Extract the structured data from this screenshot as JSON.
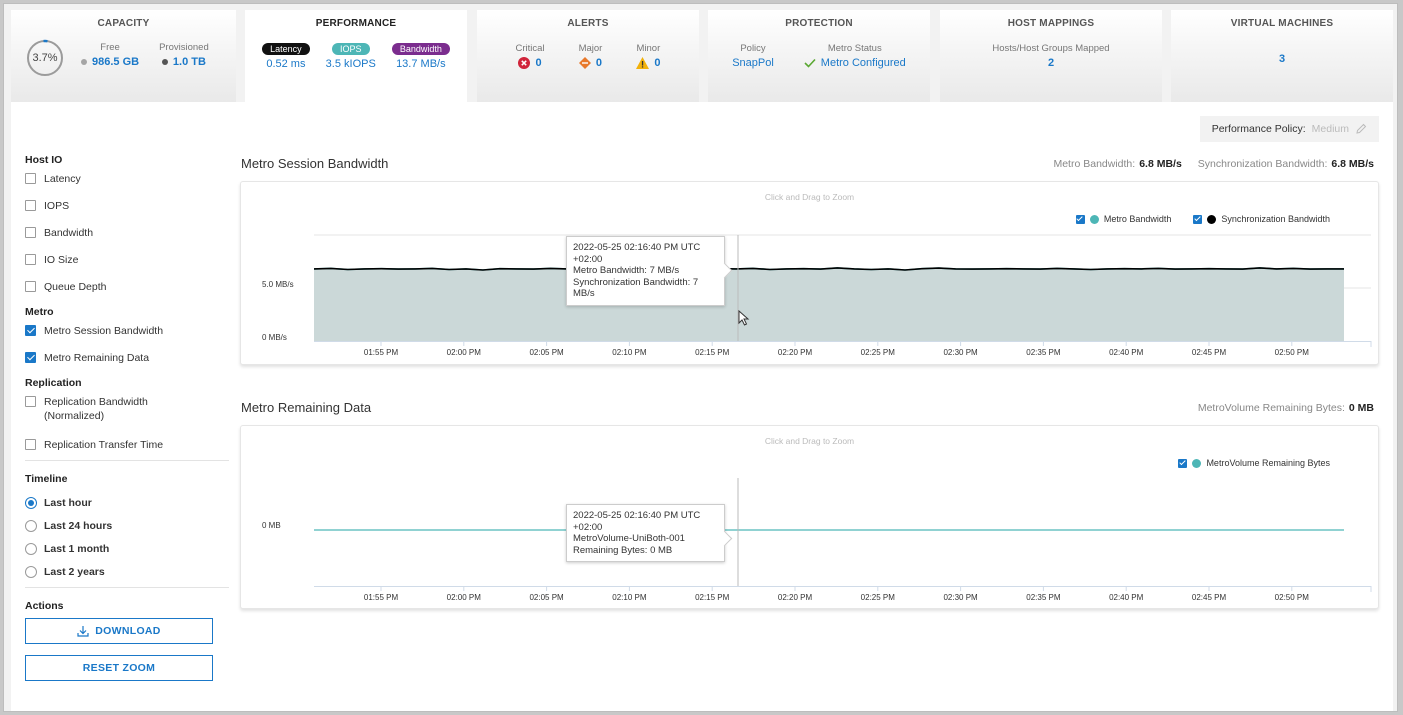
{
  "tiles": {
    "capacity": {
      "title": "CAPACITY",
      "percent_label": "3.7%",
      "percent_value": 3.7,
      "free_label": "Free",
      "free_value": "986.5 GB",
      "provisioned_label": "Provisioned",
      "provisioned_value": "1.0 TB"
    },
    "performance": {
      "title": "PERFORMANCE",
      "latency_label": "Latency",
      "latency_value": "0.52 ms",
      "iops_label": "IOPS",
      "iops_value": "3.5 kIOPS",
      "bandwidth_label": "Bandwidth",
      "bandwidth_value": "13.7 MB/s"
    },
    "alerts": {
      "title": "ALERTS",
      "critical_label": "Critical",
      "critical_value": "0",
      "major_label": "Major",
      "major_value": "0",
      "minor_label": "Minor",
      "minor_value": "0"
    },
    "protection": {
      "title": "PROTECTION",
      "policy_label": "Policy",
      "policy_value": "SnapPol",
      "metro_label": "Metro Status",
      "metro_value": "Metro Configured"
    },
    "host_mappings": {
      "title": "HOST MAPPINGS",
      "label": "Hosts/Host Groups Mapped",
      "value": "2"
    },
    "virtual_machines": {
      "title": "VIRTUAL MACHINES",
      "value": "3"
    }
  },
  "colors": {
    "accent": "#1a78c8",
    "latency_pill": "#111111",
    "iops_pill": "#4db6b6",
    "bandwidth_pill": "#7b2d8e",
    "critical": "#d0243a",
    "major": "#e8792b",
    "minor": "#f2b10a",
    "ok": "#5aa832",
    "metro_series": "#4db6b6",
    "sync_series": "#000000",
    "area_fill": "#cbd8d8"
  },
  "performance_policy": {
    "label": "Performance Policy:",
    "value": "Medium"
  },
  "sidebar": {
    "host_io": {
      "heading": "Host IO",
      "items": [
        {
          "label": "Latency",
          "checked": false
        },
        {
          "label": "IOPS",
          "checked": false
        },
        {
          "label": "Bandwidth",
          "checked": false
        },
        {
          "label": "IO Size",
          "checked": false
        },
        {
          "label": "Queue Depth",
          "checked": false
        }
      ]
    },
    "metro": {
      "heading": "Metro",
      "items": [
        {
          "label": "Metro Session Bandwidth",
          "checked": true
        },
        {
          "label": "Metro Remaining Data",
          "checked": true
        }
      ]
    },
    "replication": {
      "heading": "Replication",
      "items": [
        {
          "label": "Replication Bandwidth (Normalized)",
          "checked": false
        },
        {
          "label": "Replication Transfer Time",
          "checked": false
        }
      ]
    },
    "timeline": {
      "heading": "Timeline",
      "options": [
        {
          "label": "Last hour",
          "selected": true
        },
        {
          "label": "Last 24 hours",
          "selected": false
        },
        {
          "label": "Last 1 month",
          "selected": false
        },
        {
          "label": "Last 2 years",
          "selected": false
        }
      ]
    },
    "actions": {
      "heading": "Actions",
      "download_label": "DOWNLOAD",
      "reset_zoom_label": "RESET ZOOM"
    }
  },
  "charts": {
    "bandwidth": {
      "title": "Metro Session Bandwidth",
      "stat1_label": "Metro Bandwidth:",
      "stat1_value": "6.8 MB/s",
      "stat2_label": "Synchronization Bandwidth:",
      "stat2_value": "6.8 MB/s",
      "zoom_hint": "Click and Drag to Zoom",
      "legend": [
        "Metro Bandwidth",
        "Synchronization Bandwidth"
      ],
      "tooltip": [
        "2022-05-25 02:16:40 PM UTC",
        "+02:00",
        "Metro Bandwidth: 7 MB/s",
        "Synchronization Bandwidth: 7",
        "MB/s"
      ]
    },
    "remaining": {
      "title": "Metro Remaining Data",
      "stat1_label": "MetroVolume Remaining Bytes:",
      "stat1_value": "0 MB",
      "zoom_hint": "Click and Drag to Zoom",
      "legend": [
        "MetroVolume Remaining Bytes"
      ],
      "tooltip": [
        "2022-05-25 02:16:40 PM UTC",
        "+02:00",
        "MetroVolume-UniBoth-001",
        "Remaining Bytes: 0 MB"
      ]
    }
  },
  "chart_data": [
    {
      "type": "area",
      "title": "Metro Session Bandwidth",
      "xlabel": "",
      "ylabel": "",
      "x_ticks": [
        "01:55 PM",
        "02:00 PM",
        "02:05 PM",
        "02:10 PM",
        "02:15 PM",
        "02:20 PM",
        "02:25 PM",
        "02:30 PM",
        "02:35 PM",
        "02:40 PM",
        "02:45 PM",
        "02:50 PM"
      ],
      "y_ticks": [
        "0 MB/s",
        "5.0 MB/s"
      ],
      "ylim": [
        0,
        10
      ],
      "x_range_minutes": [
        0,
        62
      ],
      "series": [
        {
          "name": "Metro Bandwidth",
          "color": "#4db6b6",
          "values": [
            6.8,
            6.85,
            6.75,
            6.8,
            6.82,
            6.78,
            6.8,
            6.85,
            6.75,
            6.8,
            6.7,
            6.82,
            6.8,
            6.78,
            6.85,
            6.8,
            6.75,
            6.8,
            6.82,
            6.78,
            6.8,
            6.85,
            6.8,
            6.78,
            6.82,
            6.8,
            6.85,
            6.75,
            6.8,
            6.82,
            6.78,
            6.9,
            6.8,
            6.75,
            6.8,
            6.7,
            6.82,
            6.88,
            6.8,
            6.78,
            6.8,
            6.82,
            6.8,
            6.78,
            6.85,
            6.8,
            6.75,
            6.8,
            6.82,
            6.8,
            6.85,
            6.78,
            6.8,
            6.82,
            6.8,
            6.78,
            6.9,
            6.8,
            6.85,
            6.78,
            6.8,
            6.8
          ]
        },
        {
          "name": "Synchronization Bandwidth",
          "color": "#000000",
          "values": [
            6.8,
            6.85,
            6.75,
            6.8,
            6.82,
            6.78,
            6.8,
            6.85,
            6.75,
            6.8,
            6.7,
            6.82,
            6.8,
            6.78,
            6.85,
            6.8,
            6.75,
            6.8,
            6.82,
            6.78,
            6.8,
            6.85,
            6.8,
            6.78,
            6.82,
            6.8,
            6.85,
            6.75,
            6.8,
            6.82,
            6.78,
            6.9,
            6.8,
            6.75,
            6.8,
            6.7,
            6.82,
            6.88,
            6.8,
            6.78,
            6.8,
            6.82,
            6.8,
            6.78,
            6.85,
            6.8,
            6.75,
            6.8,
            6.82,
            6.8,
            6.85,
            6.78,
            6.8,
            6.82,
            6.8,
            6.78,
            6.9,
            6.8,
            6.85,
            6.78,
            6.8,
            6.8
          ]
        }
      ],
      "legend": "top-right",
      "hover_index": 26
    },
    {
      "type": "line",
      "title": "Metro Remaining Data",
      "x_ticks": [
        "01:55 PM",
        "02:00 PM",
        "02:05 PM",
        "02:10 PM",
        "02:15 PM",
        "02:20 PM",
        "02:25 PM",
        "02:30 PM",
        "02:35 PM",
        "02:40 PM",
        "02:45 PM",
        "02:50 PM"
      ],
      "y_ticks": [
        "0 MB"
      ],
      "x_range_minutes": [
        0,
        62
      ],
      "series": [
        {
          "name": "MetroVolume Remaining Bytes",
          "color": "#4db6b6",
          "values": [
            0,
            0,
            0,
            0,
            0,
            0,
            0,
            0,
            0,
            0,
            0,
            0,
            0,
            0,
            0,
            0,
            0,
            0,
            0,
            0,
            0,
            0,
            0,
            0,
            0,
            0,
            0,
            0,
            0,
            0,
            0,
            0,
            0,
            0,
            0,
            0,
            0,
            0,
            0,
            0,
            0,
            0,
            0,
            0,
            0,
            0,
            0,
            0,
            0,
            0,
            0,
            0,
            0,
            0,
            0,
            0,
            0,
            0,
            0,
            0,
            0,
            0
          ]
        }
      ],
      "legend": "top-right",
      "hover_index": 26
    }
  ]
}
